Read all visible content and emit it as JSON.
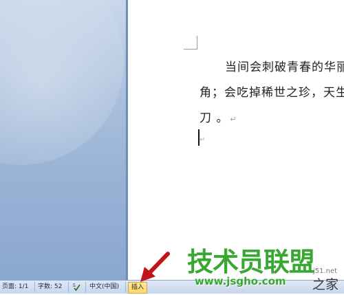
{
  "document": {
    "lines": [
      "当间会刺破青春的华丽",
      "角；会吃掉稀世之珍，天生",
      "刀 。"
    ],
    "paragraph_mark": "↵"
  },
  "statusbar": {
    "page": "页面: 1/1",
    "words": "字数: 52",
    "language": "中文(中国)",
    "insert_mode": "插入"
  },
  "watermark": {
    "logo": "技术员联盟",
    "url": "www.jsgho.com",
    "side_small": "j51.net",
    "side_big": "之家"
  },
  "colors": {
    "watermark_green": "#39a832",
    "arrow_red": "#c0141a",
    "insert_highlight": "#ffd669"
  },
  "icons": {
    "spell_check": "spell-check-icon",
    "arrow": "red-arrow-icon"
  }
}
